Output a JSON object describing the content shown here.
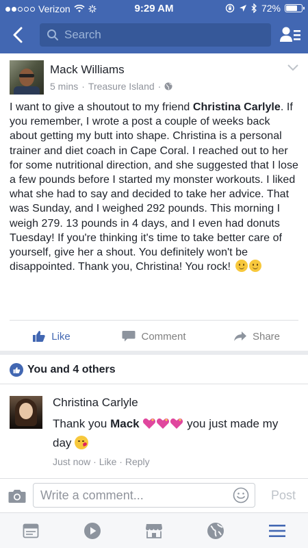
{
  "status_bar": {
    "carrier": "Verizon",
    "time": "9:29 AM",
    "battery": "72%",
    "battery_level": 0.72
  },
  "nav": {
    "search_placeholder": "Search"
  },
  "post": {
    "author": "Mack Williams",
    "time": "5 mins",
    "location": "Treasure Island",
    "body_before": "I want to give a shoutout to my friend ",
    "tagged_name": "Christina Carlyle",
    "body_after": ". If you remember, I wrote a post a couple of weeks back about getting my butt into shape. Christina is a personal trainer and diet coach in Cape Coral. I reached out to her for some nutritional direction, and she suggested that I lose a few pounds before I started my monster workouts. I liked what she had to say and decided to take her advice. That was Sunday, and I weighed 292 pounds. This morning I weigh 279. 13 pounds in 4 days, and I even had donuts Tuesday! If you're thinking it's time to take better care of yourself, give her a shout. You definitely won't be disappointed. Thank you, Christina! You rock!"
  },
  "actions": {
    "like": "Like",
    "comment": "Comment",
    "share": "Share"
  },
  "reactions": {
    "summary": "You and 4 others"
  },
  "comment": {
    "author": "Christina Carlyle",
    "text_before": "Thank you ",
    "mention": "Mack",
    "text_after": " you just made my day",
    "time": "Just now",
    "like": "Like",
    "reply": "Reply"
  },
  "composer": {
    "placeholder": "Write a comment...",
    "post_label": "Post"
  },
  "colors": {
    "brand": "#4267b2",
    "muted": "#90949c"
  }
}
